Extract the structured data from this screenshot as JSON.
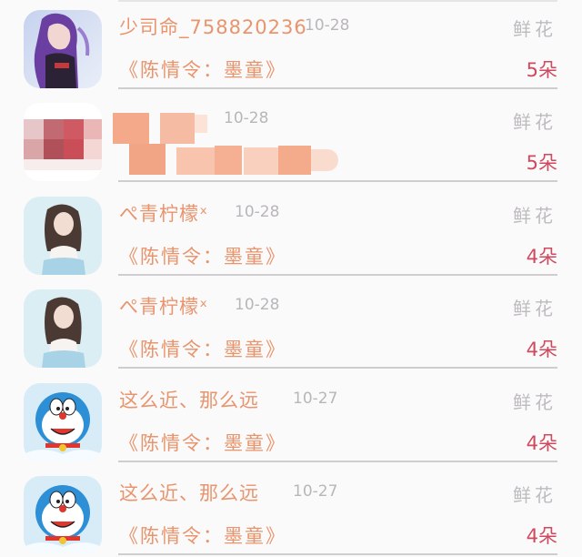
{
  "gift_label": "鲜花",
  "rows": [
    {
      "user": "少司命_758820236",
      "date": "10-28",
      "book": "《陈情令：墨童》",
      "count": "5朵",
      "avatar": "anime-girl-avatar"
    },
    {
      "user": "",
      "date": "10-28",
      "book": "",
      "count": "5朵",
      "avatar": "pixelated-avatar"
    },
    {
      "user": "ぺ青柠檬ˣ",
      "date": "10-28",
      "book": "《陈情令：墨童》",
      "count": "4朵",
      "avatar": "girl-photo-avatar"
    },
    {
      "user": "ぺ青柠檬ˣ",
      "date": "10-28",
      "book": "《陈情令：墨童》",
      "count": "4朵",
      "avatar": "girl-photo-avatar"
    },
    {
      "user": "这么近、那么远",
      "date": "10-27",
      "book": "《陈情令：墨童》",
      "count": "4朵",
      "avatar": "doraemon-avatar"
    },
    {
      "user": "这么近、那么远",
      "date": "10-27",
      "book": "《陈情令：墨童》",
      "count": "4朵",
      "avatar": "doraemon-avatar"
    }
  ],
  "colors": {
    "accent": "#e8946d",
    "count": "#cf4a5e",
    "muted": "#b8b6b9"
  }
}
